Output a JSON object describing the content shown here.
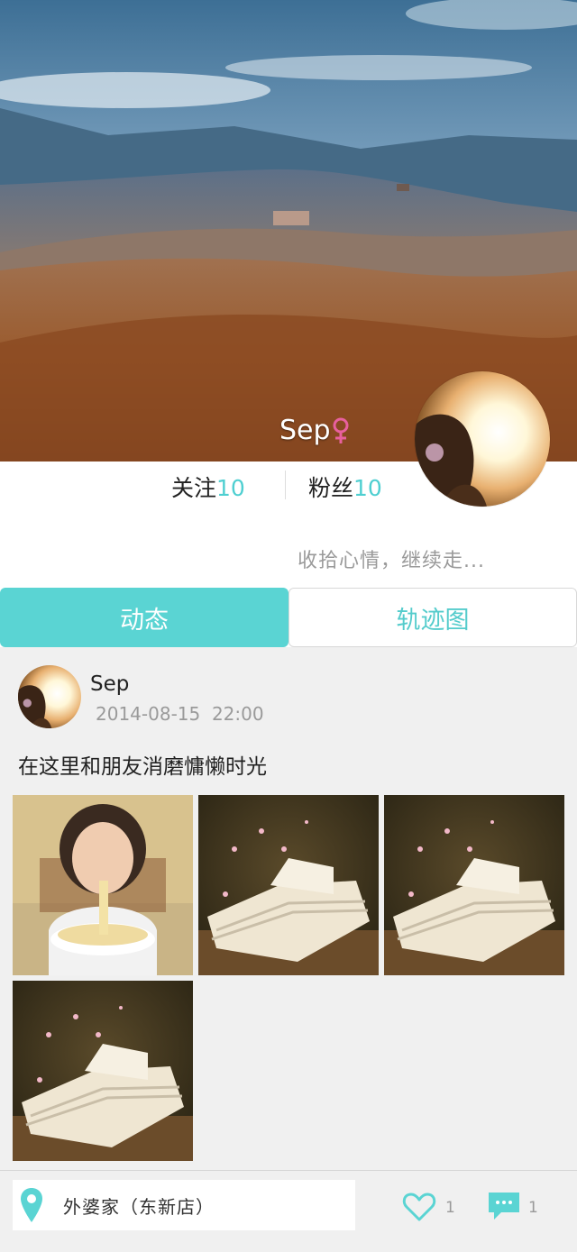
{
  "profile": {
    "username": "Sep",
    "gender_icon": "female-icon",
    "follow_label": "关注",
    "follow_count": "10",
    "fans_label": "粉丝",
    "fans_count": "10",
    "signature": "收拾心情，继续走..."
  },
  "tabs": [
    {
      "label": "动态",
      "active": true
    },
    {
      "label": "轨迹图",
      "active": false
    }
  ],
  "post": {
    "author": "Sep",
    "time": "2014-08-15  22:00",
    "text": "在这里和朋友消磨慵懒时光",
    "photos": [
      "girl-eating-noodles",
      "open-book-petals",
      "open-book-petals",
      "open-book-petals"
    ],
    "location": "外婆家（东新店）",
    "likes": "1",
    "comments": "1"
  },
  "colors": {
    "accent": "#5ad4d3",
    "accent_text": "#4fcfd1",
    "female": "#e8609e",
    "feed_bg": "#f0f0f0"
  }
}
